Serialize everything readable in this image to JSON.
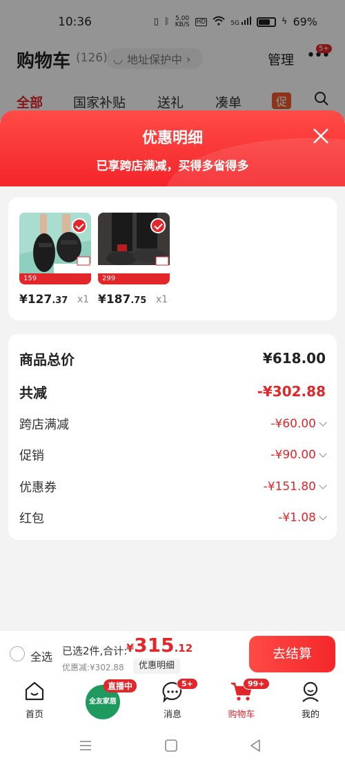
{
  "status_bar": {
    "time": "10:36",
    "net_speed_top": "5.00",
    "net_speed_bottom": "KB/S",
    "hd": "HD",
    "signal": "5G",
    "battery": "69%"
  },
  "cart_header": {
    "title": "购物车",
    "count": "(126)",
    "address": "地址保护中",
    "manage": "管理",
    "more_badge": "5+"
  },
  "tabs": [
    {
      "label": "全部",
      "active": true
    },
    {
      "label": "国家补贴",
      "active": false
    },
    {
      "label": "送礼",
      "active": false
    },
    {
      "label": "凑单",
      "active": false
    }
  ],
  "promo_tab": "促",
  "sheet": {
    "title": "优惠明细",
    "subtitle": "已享跨店满减，买得多省得多"
  },
  "products": [
    {
      "price_int": "¥127",
      "price_dec": ".37",
      "qty": "x1",
      "tag_price": "159",
      "image": "black-sandals"
    },
    {
      "price_int": "¥187",
      "price_dec": ".75",
      "qty": "x1",
      "tag_price": "299",
      "image": "black-shoes"
    }
  ],
  "summary": {
    "total_label": "商品总价",
    "total_value": "¥618.00",
    "reduce_label": "共减",
    "reduce_value": "-¥302.88",
    "items": [
      {
        "label": "跨店满减",
        "value": "-¥60.00"
      },
      {
        "label": "促销",
        "value": "-¥90.00"
      },
      {
        "label": "优惠券",
        "value": "-¥151.80"
      },
      {
        "label": "红包",
        "value": "-¥1.08"
      }
    ]
  },
  "checkout": {
    "select_all": "全选",
    "selected_text": "已选2件,合计:",
    "price_currency": "¥",
    "price_int": "315",
    "price_dec": ".12",
    "discount_text": "优惠减:¥302.88",
    "detail_chip": "优惠明细",
    "checkout_button": "去结算"
  },
  "tabbar": {
    "home": "首页",
    "live_badge": "直播中",
    "live_text": "全友家居",
    "messages": "消息",
    "messages_badge": "5+",
    "cart": "购物车",
    "cart_badge": "99+",
    "mine": "我的"
  },
  "colors": {
    "accent": "#e3262a",
    "header_gradient_top": "#ff4b46",
    "live_green": "#1e9a5f"
  }
}
